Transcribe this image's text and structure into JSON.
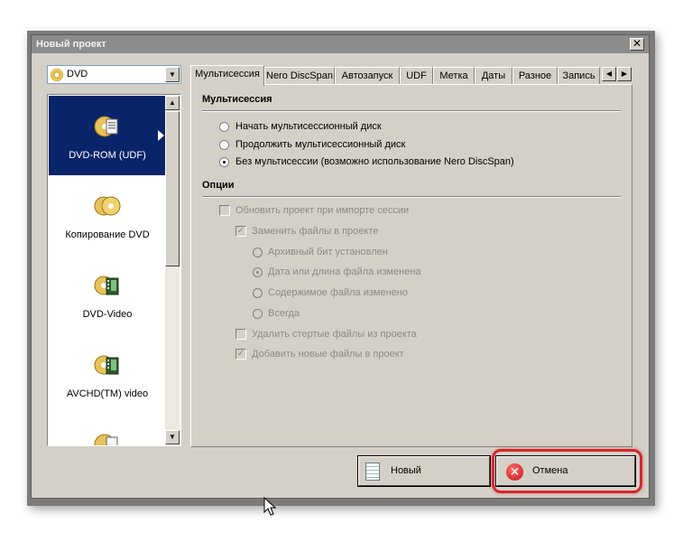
{
  "window": {
    "title": "Новый проект",
    "close_label": "✕"
  },
  "left_panel": {
    "dropdown_value": "DVD",
    "projects": [
      {
        "label": "DVD-ROM (UDF)",
        "icon": "dvd-rom-icon",
        "selected": true
      },
      {
        "label": "Копирование DVD",
        "icon": "dvd-copy-icon",
        "selected": false
      },
      {
        "label": "DVD-Video",
        "icon": "dvd-video-icon",
        "selected": false
      },
      {
        "label": "AVCHD(TM) video",
        "icon": "avchd-video-icon",
        "selected": false
      }
    ]
  },
  "tabs": [
    "Мультисессия",
    "Nero DiscSpan",
    "Автозапуск",
    "UDF",
    "Метка",
    "Даты",
    "Разное",
    "Запись"
  ],
  "active_tab": "Мультисессия",
  "multisession": {
    "header": "Мультисессия",
    "options": [
      {
        "label": "Начать мультисессионный диск",
        "selected": false
      },
      {
        "label": "Продолжить мультисессионный диск",
        "selected": false
      },
      {
        "label": "Без мультисессии (возможно использование Nero DiscSpan)",
        "selected": true
      }
    ]
  },
  "options": {
    "header": "Опции",
    "update_project": {
      "label": "Обновить проект при импорте сессии",
      "checked": false
    },
    "replace_files": {
      "label": "Заменить файлы в проекте",
      "checked": true
    },
    "replace_radios": [
      {
        "label": "Архивный бит установлен",
        "selected": false
      },
      {
        "label": "Дата или длина файла изменена",
        "selected": true
      },
      {
        "label": "Содержимое файла изменено",
        "selected": false
      },
      {
        "label": "Всегда",
        "selected": false
      }
    ],
    "delete_erased": {
      "label": "Удалить стертые файлы из проекта",
      "checked": false
    },
    "add_new": {
      "label": "Добавить новые файлы в проект",
      "checked": true
    }
  },
  "buttons": {
    "new_label": "Новый",
    "cancel_label": "Отмена"
  },
  "colors": {
    "selection": "#0a246a",
    "highlight": "#d7262b",
    "title_bar": "#8c8c8c"
  }
}
